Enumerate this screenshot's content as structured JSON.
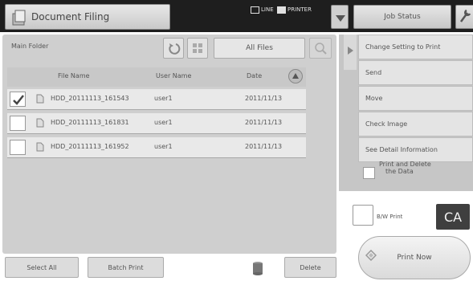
{
  "header": {
    "title": "Document Filing",
    "indicators": [
      "LINE",
      "PRINTER"
    ],
    "job_status": "Job Status"
  },
  "folder": {
    "label": "Main Folder",
    "filter": "All Files"
  },
  "table": {
    "columns": [
      "File Name",
      "User Name",
      "Date"
    ],
    "rows": [
      {
        "file": "HDD_20111113_161543",
        "user": "user1",
        "date": "2011/11/13",
        "checked": true
      },
      {
        "file": "HDD_20111113_161831",
        "user": "user1",
        "date": "2011/11/13",
        "checked": false
      },
      {
        "file": "HDD_20111113_161952",
        "user": "user1",
        "date": "2011/11/13",
        "checked": false
      }
    ]
  },
  "actions": [
    "Change Setting to Print",
    "Send",
    "Move",
    "Check Image",
    "See Detail Information"
  ],
  "print_delete": {
    "line1": "Print and Delete",
    "line2": "the Data"
  },
  "bottom": {
    "select_all": "Select All",
    "batch_print": "Batch Print",
    "delete": "Delete"
  },
  "bw_print": "B/W Print",
  "ca": "CA",
  "print_now": "Print Now"
}
